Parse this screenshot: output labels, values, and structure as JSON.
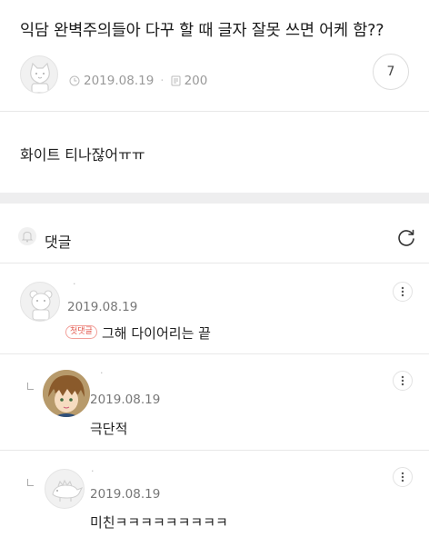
{
  "post": {
    "title": "익담 완벽주의들아 다꾸 할 때 글자 잘못 쓰면 어케 함??",
    "date": "2019.08.19",
    "views": "200",
    "comment_count": "7",
    "body": "화이트 티나잖어ㅠㅠ"
  },
  "comments_section": {
    "label": "댓글"
  },
  "comments": [
    {
      "author": "·",
      "date": "2019.08.19",
      "badge": "첫댓글",
      "text": "그해 다이어리는 끝"
    },
    {
      "author": "·",
      "date": "2019.08.19",
      "text": "극단적"
    },
    {
      "author": "·",
      "date": "2019.08.19",
      "text": "미친ㅋㅋㅋㅋㅋㅋㅋㅋㅋ"
    }
  ]
}
